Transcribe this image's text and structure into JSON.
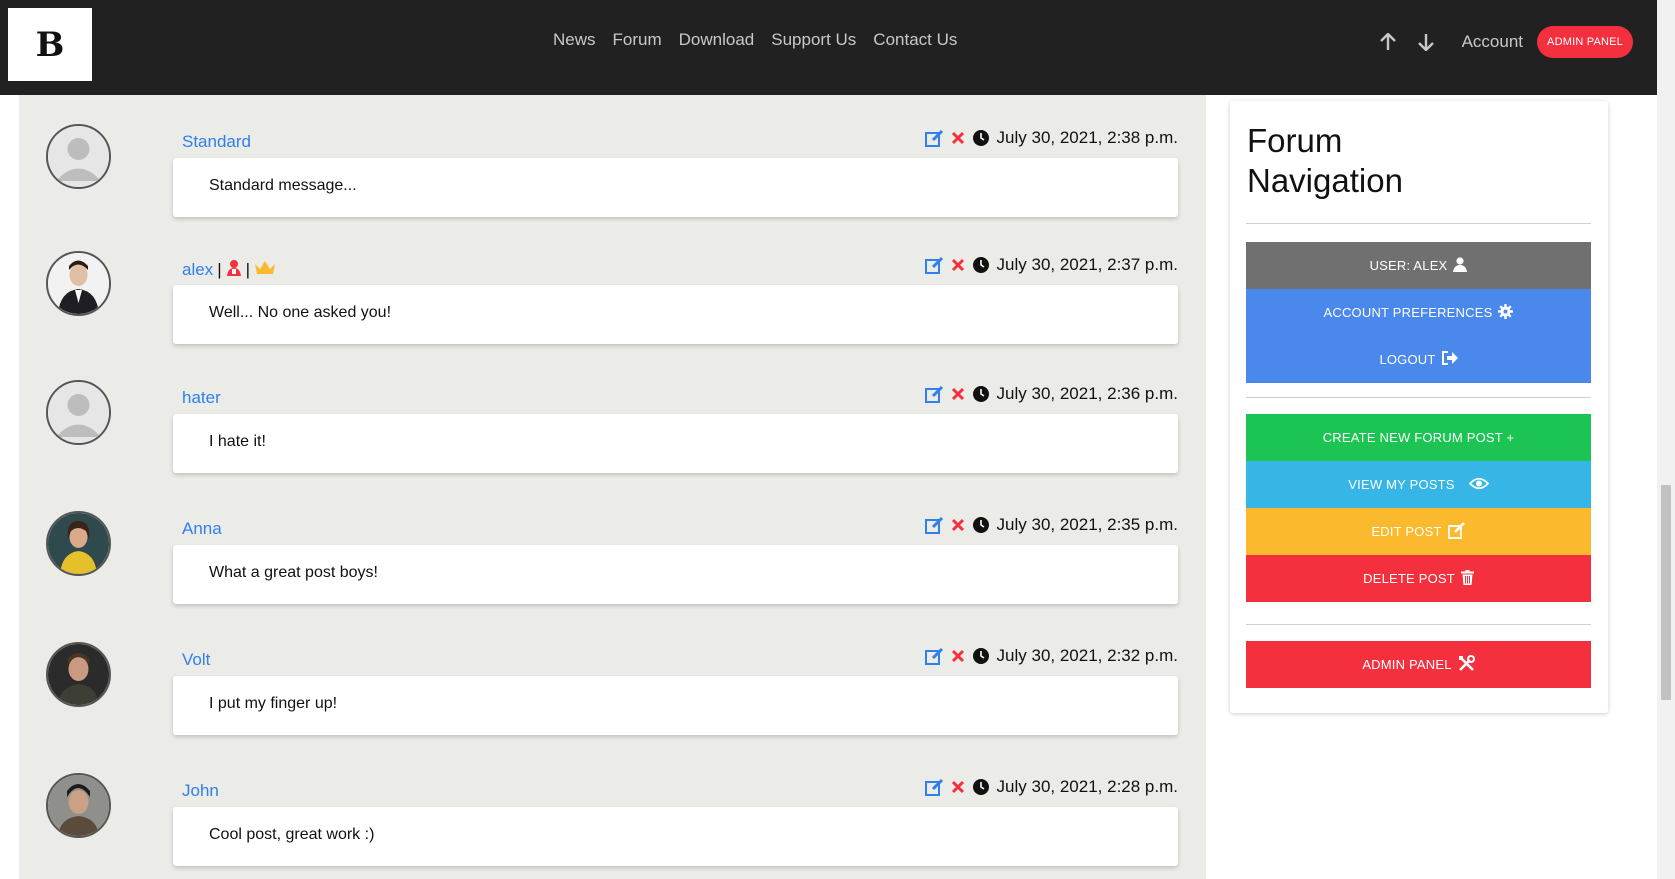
{
  "header": {
    "logo_text": "B",
    "nav": [
      "News",
      "Forum",
      "Download",
      "Support Us",
      "Contact Us"
    ],
    "account_label": "Account",
    "admin_label": "ADMIN PANEL"
  },
  "posts": [
    {
      "author": "Standard",
      "date": "July 30, 2021, 2:38 p.m.",
      "message": "Standard message..."
    },
    {
      "author": "alex",
      "date": "July 30, 2021, 2:37 p.m.",
      "message": "Well... No one asked you!"
    },
    {
      "author": "hater",
      "date": "July 30, 2021, 2:36 p.m.",
      "message": "I hate it!"
    },
    {
      "author": "Anna",
      "date": "July 30, 2021, 2:35 p.m.",
      "message": "What a great post boys!"
    },
    {
      "author": "Volt",
      "date": "July 30, 2021, 2:32 p.m.",
      "message": "I put my finger up!"
    },
    {
      "author": "John",
      "date": "July 30, 2021, 2:28 p.m.",
      "message": "Cool post, great work :)"
    }
  ],
  "badge_separator": "|",
  "sidebar": {
    "title": "Forum Navigation",
    "user_btn": "USER: ALEX",
    "prefs_btn": "ACCOUNT PREFERENCES",
    "logout_btn": "LOGOUT",
    "create_btn": "CREATE NEW FORUM POST +",
    "view_btn": "VIEW MY POSTS",
    "edit_btn": "EDIT POST",
    "delete_btn": "DELETE POST",
    "admin_btn": "ADMIN PANEL"
  },
  "colors": {
    "user": "#707070",
    "blue": "#4a88ec",
    "green": "#1cc453",
    "cyan": "#35b6e6",
    "amber": "#fbb92d",
    "red": "#f5303e",
    "link": "#2f80ed"
  },
  "icons": {
    "edit": "pencil-square-icon",
    "delete": "x-icon",
    "clock": "clock-icon"
  }
}
